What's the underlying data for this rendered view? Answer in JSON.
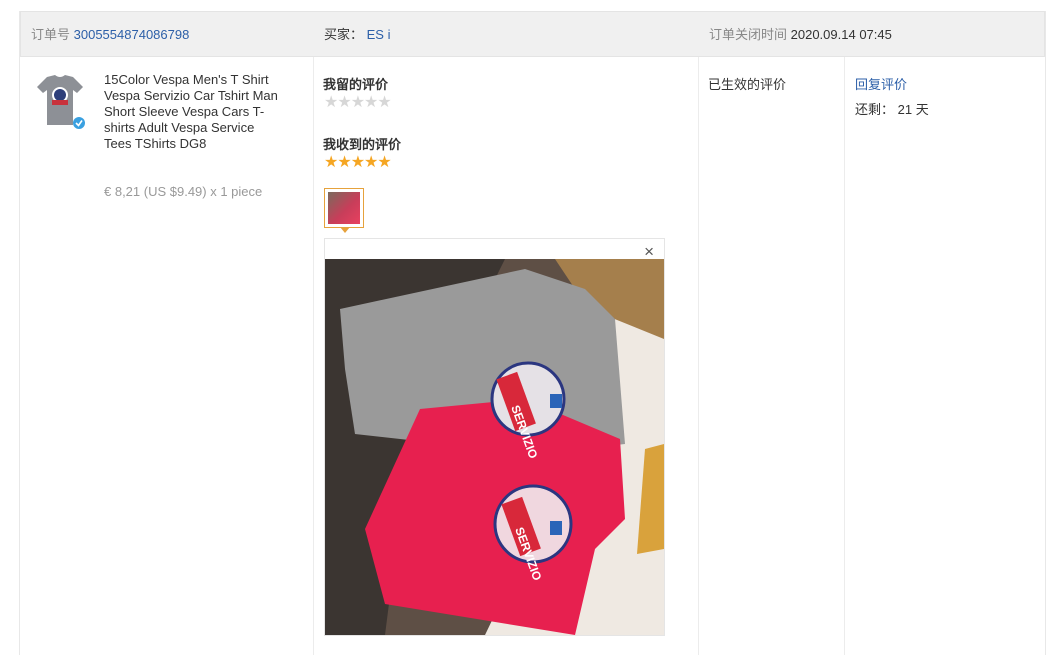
{
  "order": {
    "number_label": "订单号",
    "number": "3005554874086798",
    "buyer_label": "买家：",
    "buyer": "ES i",
    "closed_label": "订单关闭时间",
    "closed_time": "2020.09.14 07:45"
  },
  "product": {
    "icon": "tshirt-thumbnail",
    "title": "15Color Vespa Men's T Shirt Vespa Servizio Car Tshirt Man Short Sleeve Vespa Cars T-shirts Adult Vespa Service Tees TShirts DG8",
    "price": "€ 8,21 (US $9.49) x 1 piece"
  },
  "feedback": {
    "my_review_label": "我留的评价",
    "my_rating": 0,
    "received_label": "我收到的评价",
    "received_rating": 5,
    "close_symbol": "×",
    "photo_text_1": "SERVIZIO",
    "photo_text_2": "SERVIZIO"
  },
  "status": {
    "effective_label": "已生效的评价"
  },
  "actions": {
    "reply_label": "回复评价",
    "remaining_label": "还剩：",
    "remaining_value": "21 天"
  },
  "colors": {
    "link": "#2c5fa8",
    "star_full": "#f5a623",
    "star_empty": "#d7d7d7",
    "selected_border": "#e6a23c"
  }
}
